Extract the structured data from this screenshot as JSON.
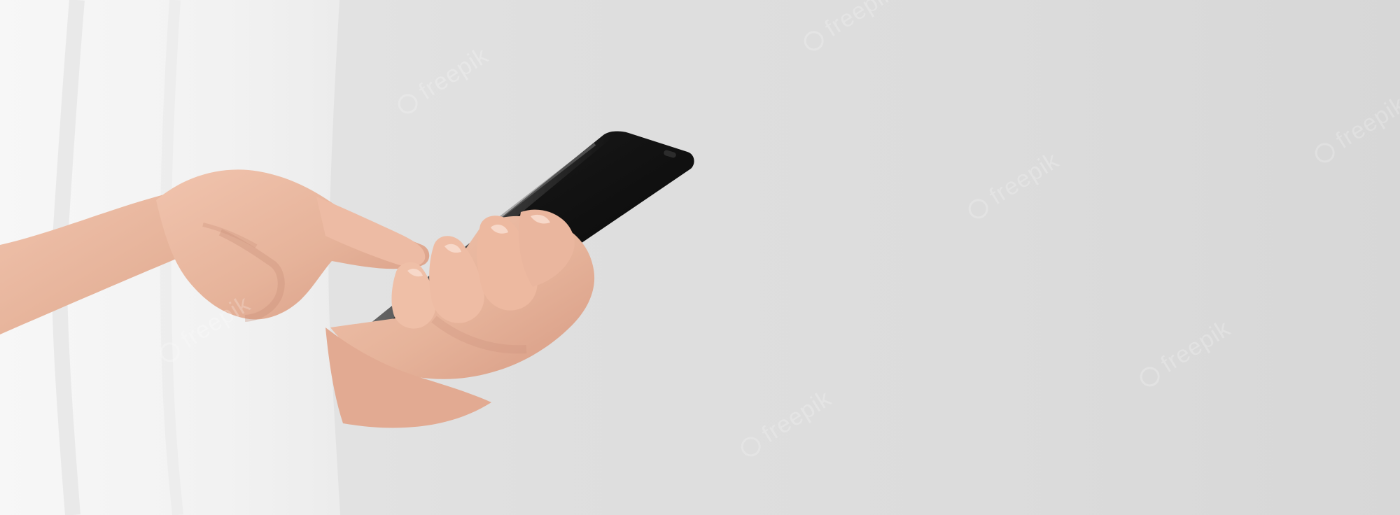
{
  "image": {
    "scene": "hands holding black smartphone against light gray background",
    "colors": {
      "background": "#dcdcdc",
      "shirt": "#f4f4f4",
      "skin": "#e9b7a1",
      "skin_shadow": "#c98f78",
      "phone": "#111111"
    }
  },
  "watermark": {
    "text": "freepik"
  }
}
